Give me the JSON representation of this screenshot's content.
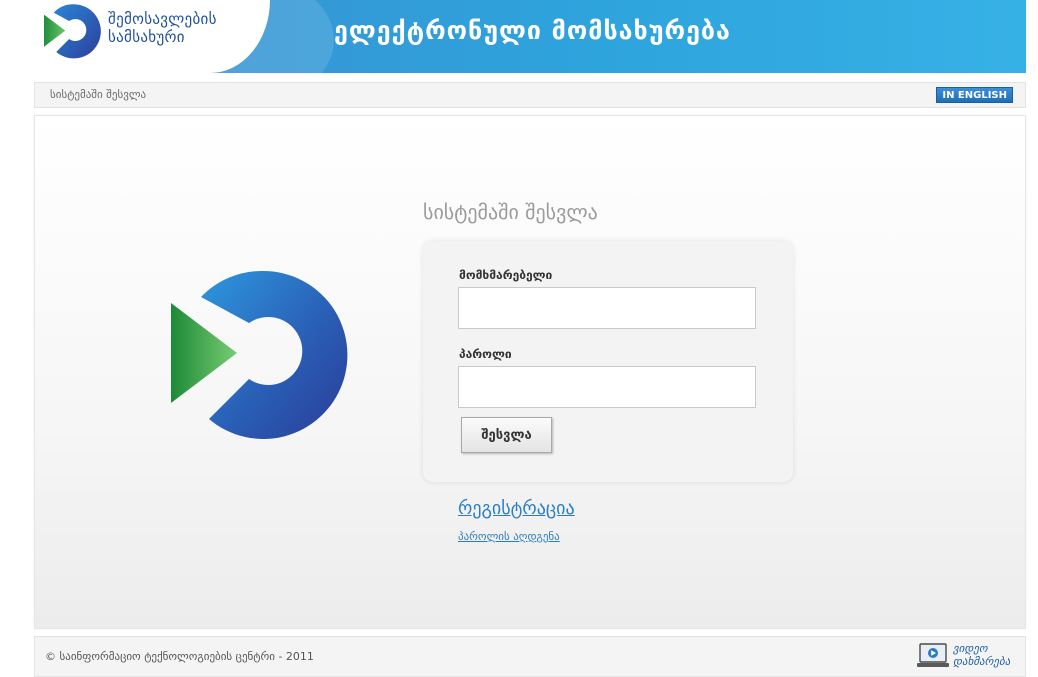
{
  "header": {
    "logo_line1": "შემოსავლების",
    "logo_line2": "სამსახური",
    "banner_title": "ელექტრონული მომსახურება"
  },
  "breadcrumb": {
    "current": "სისტემაში შესვლა",
    "language_button": "IN ENGLISH"
  },
  "login": {
    "title": "სისტემაში შესვლა",
    "username_label": "მომხმარებელი",
    "username_value": "",
    "password_label": "პაროლი",
    "password_value": "",
    "submit_label": "შესვლა",
    "register_link": "რეგისტრაცია",
    "recover_link": "პაროლის აღდგენა"
  },
  "footer": {
    "copyright": "© საინფორმაციო ტექნოლოგიების ცენტრი - 2011",
    "video_help_line1": "ვიდეო",
    "video_help_line2": "დახმარება"
  },
  "colors": {
    "banner_blue": "#2ea3dc",
    "logo_blue": "#1e4f9a",
    "logo_green": "#2fa84f",
    "link_blue": "#2a7dc4"
  },
  "icons": {
    "logo": "revenue-service-logo-icon",
    "video": "video-help-icon"
  }
}
